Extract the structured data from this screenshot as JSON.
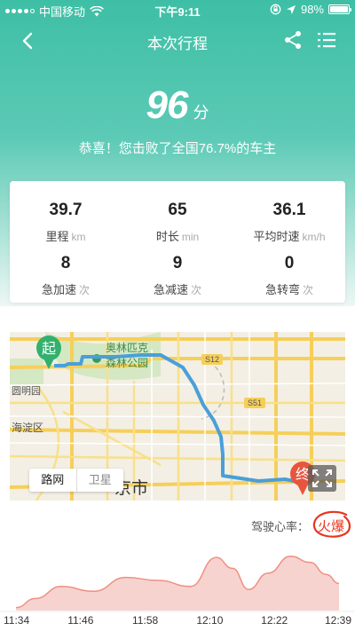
{
  "status": {
    "carrier": "中国移动",
    "time": "下午9:11",
    "battery": "98%",
    "battery_level": 0.98
  },
  "nav": {
    "title": "本次行程",
    "back_icon": "chevron-left-icon",
    "share_icon": "share-icon",
    "menu_icon": "list-menu-icon"
  },
  "score": {
    "value": "96",
    "unit": "分",
    "message": "恭喜！您击败了全国76.7%的车主"
  },
  "stats": [
    {
      "value": "39.7",
      "label": "里程",
      "unit": "km"
    },
    {
      "value": "65",
      "label": "时长",
      "unit": "min"
    },
    {
      "value": "36.1",
      "label": "平均时速",
      "unit": "km/h"
    },
    {
      "value": "8",
      "label": "急加速",
      "unit": "次"
    },
    {
      "value": "9",
      "label": "急减速",
      "unit": "次"
    },
    {
      "value": "0",
      "label": "急转弯",
      "unit": "次"
    }
  ],
  "map": {
    "start_label": "起",
    "end_label": "终",
    "place_labels": {
      "park1": "奥林匹克",
      "park2": "森林公园",
      "garden": "圆明园",
      "district": "海淀区",
      "city": "京市",
      "road1": "S12",
      "road2": "S51"
    },
    "mode_road": "路网",
    "mode_satellite": "卫星",
    "route_color": "#4a9fd8"
  },
  "heart_rate": {
    "label": "驾驶心率：",
    "value": "火爆",
    "value_color": "#e8351e"
  },
  "chart_data": {
    "type": "area",
    "x": [
      "11:34",
      "11:46",
      "11:58",
      "12:10",
      "12:22",
      "12:39"
    ],
    "x_ticks": [
      "11:34",
      "11:46",
      "11:58",
      "12:10",
      "12:22",
      "12:39"
    ],
    "points": [
      [
        0.0,
        0.05
      ],
      [
        0.06,
        0.2
      ],
      [
        0.14,
        0.4
      ],
      [
        0.24,
        0.32
      ],
      [
        0.34,
        0.55
      ],
      [
        0.44,
        0.5
      ],
      [
        0.54,
        0.4
      ],
      [
        0.62,
        0.88
      ],
      [
        0.67,
        0.7
      ],
      [
        0.72,
        0.35
      ],
      [
        0.78,
        0.62
      ],
      [
        0.85,
        0.9
      ],
      [
        0.91,
        0.8
      ],
      [
        0.96,
        0.6
      ],
      [
        1.0,
        0.45
      ]
    ],
    "fill_color": "#f7d3cf",
    "line_color": "#f08f82",
    "grid": false
  }
}
